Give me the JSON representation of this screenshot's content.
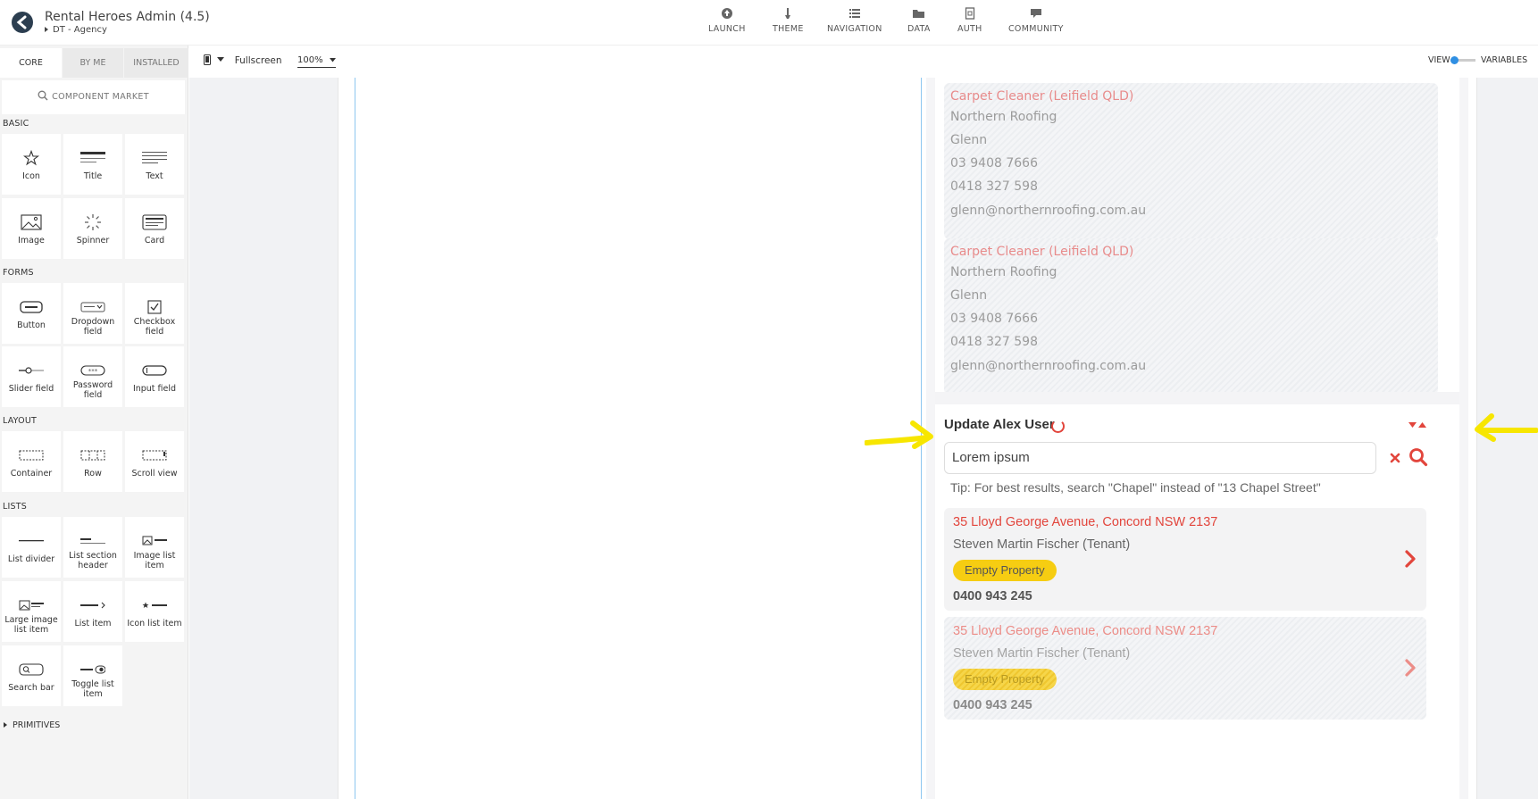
{
  "app": {
    "title": "Rental Heroes Admin (4.5)",
    "subtitle": "DT - Agency"
  },
  "nav": [
    {
      "label": "LAUNCH",
      "icon": "rocket-icon"
    },
    {
      "label": "THEME",
      "icon": "brush-icon"
    },
    {
      "label": "NAVIGATION",
      "icon": "list-icon"
    },
    {
      "label": "DATA",
      "icon": "folder-icon"
    },
    {
      "label": "AUTH",
      "icon": "document-icon"
    },
    {
      "label": "COMMUNITY",
      "icon": "chat-icon"
    }
  ],
  "sidebar": {
    "tabs": [
      "CORE",
      "BY ME",
      "INSTALLED"
    ],
    "market_label": "COMPONENT MARKET",
    "sections": {
      "basic": "BASIC",
      "forms": "FORMS",
      "layout": "LAYOUT",
      "lists": "LISTS"
    },
    "components": {
      "icon": "Icon",
      "title": "Title",
      "text": "Text",
      "image": "Image",
      "spinner": "Spinner",
      "card": "Card",
      "button": "Button",
      "dropdown": "Dropdown field",
      "checkbox": "Checkbox field",
      "slider": "Slider field",
      "password": "Password field",
      "input": "Input field",
      "container": "Container",
      "row": "Row",
      "scrollview": "Scroll view",
      "listdivider": "List divider",
      "listsection": "List section header",
      "imagelist": "Image list item",
      "largeimage": "Large image list item",
      "listitem": "List item",
      "iconlist": "Icon list item",
      "searchbar": "Search bar",
      "togglelist": "Toggle list item"
    },
    "primitives": "PRIMITIVES"
  },
  "toolbar": {
    "device_mode": "Fullscreen",
    "zoom": "100%",
    "view_label": "VIEW",
    "variables_label": "VARIABLES"
  },
  "contacts": [
    {
      "title": "Carpet Cleaner (Leifield QLD)",
      "company": "Northern Roofing",
      "name": "Glenn",
      "phone1": "03 9408 7666",
      "phone2": "0418 327 598",
      "email": "glenn@northernroofing.com.au"
    },
    {
      "title": "Carpet Cleaner (Leifield QLD)",
      "company": "Northern Roofing",
      "name": "Glenn",
      "phone1": "03 9408 7666",
      "phone2": "0418 327 598",
      "email": "glenn@northernroofing.com.au"
    }
  ],
  "update_section": {
    "title": "Update Alex User",
    "search_value": "Lorem ipsum",
    "tip": "Tip: For best results, search \"Chapel\" instead of \"13 Chapel Street\""
  },
  "properties": [
    {
      "address": "35 Lloyd George Avenue, Concord NSW 2137",
      "tenant": "Steven Martin Fischer (Tenant)",
      "status": "Empty Property",
      "phone": "0400 943 245"
    },
    {
      "address": "35 Lloyd George Avenue, Concord NSW 2137",
      "tenant": "Steven Martin Fischer (Tenant)",
      "status": "Empty Property",
      "phone": "0400 943 245"
    }
  ],
  "colors": {
    "accent_red": "#e2453c",
    "badge_yellow": "#f6cd12",
    "toggle_blue": "#2f8fe3",
    "annotation_yellow": "#f7e600"
  }
}
